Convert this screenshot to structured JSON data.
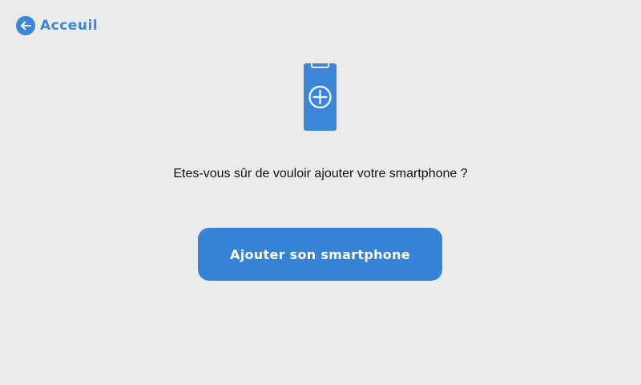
{
  "colors": {
    "background": "#ebebeb",
    "accent": "#3b86d8",
    "button": "#3583d5",
    "button_text": "#ffffff",
    "text": "#111111"
  },
  "nav": {
    "back_label": "Acceuil",
    "back_icon": "arrow-left-circle-icon"
  },
  "illustration": {
    "icon": "smartphone-add-icon"
  },
  "dialog": {
    "question": "Etes-vous sûr de vouloir ajouter votre smartphone ?",
    "confirm_label": "Ajouter son smartphone"
  }
}
